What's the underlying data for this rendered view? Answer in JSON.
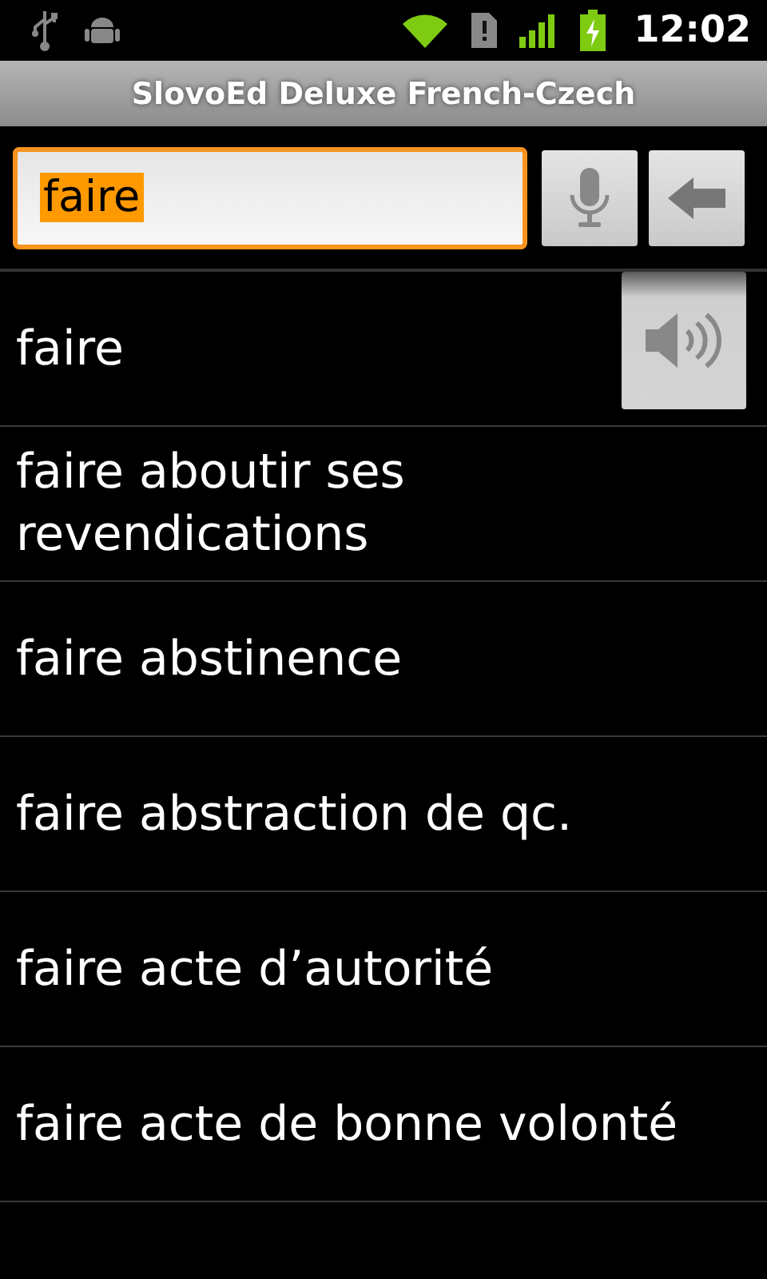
{
  "status_bar": {
    "time": "12:02"
  },
  "window": {
    "title": "SlovoEd Deluxe French-Czech"
  },
  "search": {
    "value": "faire",
    "focused": true,
    "text_selected": true
  },
  "entries": [
    {
      "text": "faire",
      "speaker": true
    },
    {
      "text": "faire aboutir ses revendications",
      "speaker": false
    },
    {
      "text": "faire abstinence",
      "speaker": false
    },
    {
      "text": "faire abstraction de qc.",
      "speaker": false
    },
    {
      "text": "faire acte d’autorité",
      "speaker": false
    },
    {
      "text": "faire acte de bonne volonté",
      "speaker": false
    }
  ]
}
